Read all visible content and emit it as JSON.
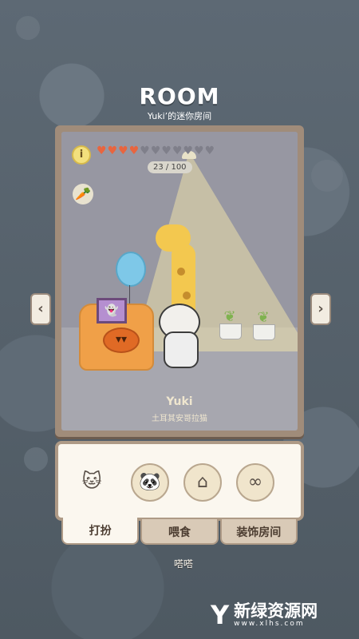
{
  "header": {
    "title": "ROOM",
    "subtitle": "Yuki’的迷你房间"
  },
  "status": {
    "info_label": "i",
    "hearts_total": 11,
    "hearts_filled": 4,
    "counter": "23 / 100"
  },
  "pet": {
    "name": "Yuki",
    "breed": "土耳其安哥拉猫"
  },
  "nav": {
    "prev": "‹",
    "next": "›"
  },
  "tabs": [
    {
      "label": "打扮"
    },
    {
      "label": "喂食"
    },
    {
      "label": "装饰房间"
    }
  ],
  "bottom_text": "嗒嗒",
  "watermark": {
    "logo": "Y",
    "text": "新绿资源网",
    "url": "www.xlhs.com"
  },
  "colors": {
    "accent": "#e8653f",
    "frame": "#a08c7a",
    "panel": "#fbf7ef"
  }
}
